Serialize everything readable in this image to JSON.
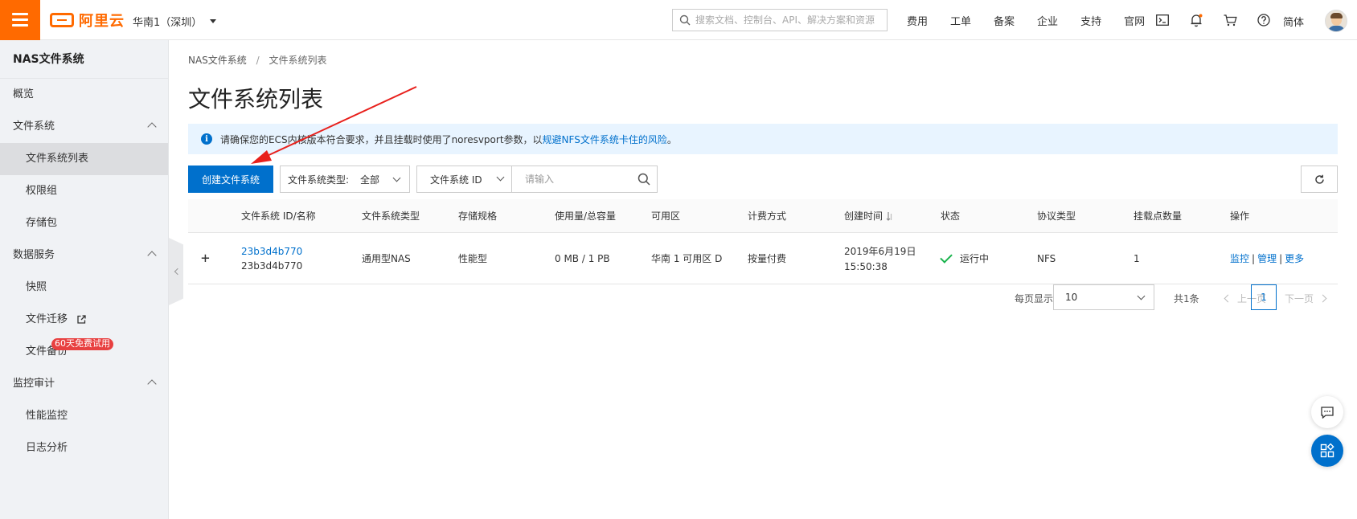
{
  "topbar": {
    "logo_text": "阿里云",
    "region": "华南1（深圳）",
    "search_placeholder": "搜索文档、控制台、API、解决方案和资源",
    "nav": [
      "费用",
      "工单",
      "备案",
      "企业",
      "支持",
      "官网"
    ],
    "lang": "简体",
    "colors": {
      "brand": "#ff6a00",
      "primary": "#0070cc"
    }
  },
  "sidebar": {
    "title": "NAS文件系统",
    "items": [
      {
        "label": "概览"
      },
      {
        "label": "文件系统"
      },
      {
        "label": "文件系统列表"
      },
      {
        "label": "权限组"
      },
      {
        "label": "存储包"
      },
      {
        "label": "数据服务"
      },
      {
        "label": "快照"
      },
      {
        "label": "文件迁移"
      },
      {
        "label": "文件备份",
        "badge": "60天免费试用"
      },
      {
        "label": "监控审计"
      },
      {
        "label": "性能监控"
      },
      {
        "label": "日志分析"
      }
    ]
  },
  "breadcrumb": {
    "root": "NAS文件系统",
    "sep": "/",
    "current": "文件系统列表"
  },
  "page_title": "文件系统列表",
  "notice": {
    "text": "请确保您的ECS内核版本符合要求，并且挂载时使用了noresvport参数，以",
    "link": "规避NFS文件系统卡住的风险",
    "end": "。"
  },
  "toolbar": {
    "create_button": "创建文件系统",
    "type_label": "文件系统类型:",
    "type_value": "全部",
    "filter_key": "文件系统 ID",
    "filter_placeholder": "请输入"
  },
  "table": {
    "headers": [
      "文件系统 ID/名称",
      "文件系统类型",
      "存储规格",
      "使用量/总容量",
      "可用区",
      "计费方式",
      "创建时间",
      "状态",
      "协议类型",
      "挂载点数量",
      "操作"
    ],
    "rows": [
      {
        "expand": "+",
        "id": "23b3d4b770",
        "name": "23b3d4b770",
        "type": "通用型NAS",
        "spec": "性能型",
        "usage": "0 MB / 1 PB",
        "zone": "华南 1 可用区 D",
        "billing": "按量付费",
        "created_date": "2019年6月19日",
        "created_time": "15:50:38",
        "status": "运行中",
        "protocol": "NFS",
        "mounts": "1",
        "ops": [
          "监控",
          "管理",
          "更多"
        ]
      }
    ]
  },
  "pagination": {
    "page_size_label": "每页显示",
    "page_size": "10",
    "total": "共1条",
    "prev": "上一页",
    "current": "1",
    "next": "下一页"
  }
}
